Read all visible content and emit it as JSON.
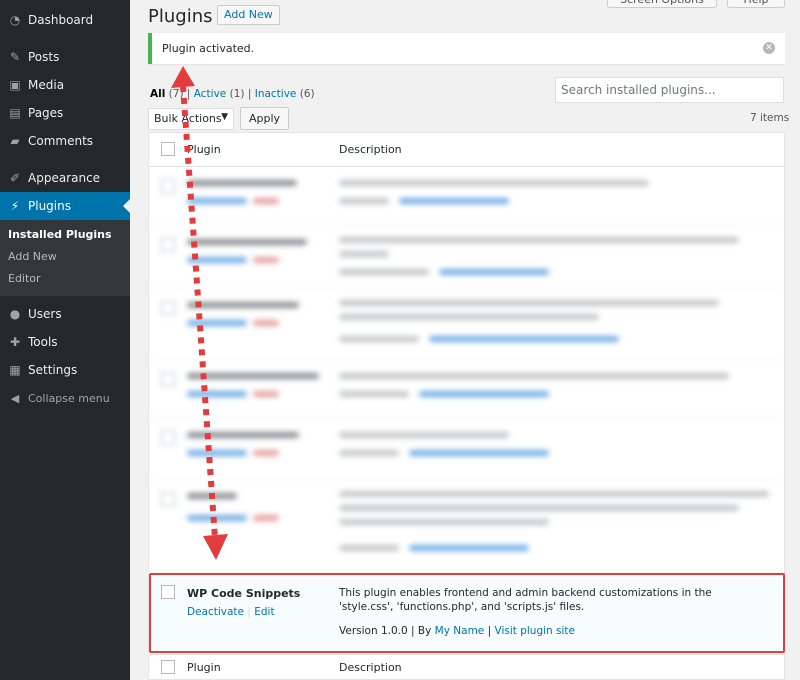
{
  "sidebar": {
    "items": [
      {
        "label": "Dashboard",
        "icon": "dashboard-icon"
      },
      {
        "label": "Posts",
        "icon": "pin-icon"
      },
      {
        "label": "Media",
        "icon": "media-icon"
      },
      {
        "label": "Pages",
        "icon": "page-icon"
      },
      {
        "label": "Comments",
        "icon": "comment-icon"
      },
      {
        "label": "Appearance",
        "icon": "brush-icon"
      },
      {
        "label": "Plugins",
        "icon": "plugin-icon"
      },
      {
        "label": "Users",
        "icon": "user-icon"
      },
      {
        "label": "Tools",
        "icon": "wrench-icon"
      },
      {
        "label": "Settings",
        "icon": "settings-icon"
      }
    ],
    "submenu": [
      "Installed Plugins",
      "Add New",
      "Editor"
    ],
    "collapse_label": "Collapse menu"
  },
  "header": {
    "title": "Plugins",
    "add_new": "Add New",
    "screen_options": "Screen Options",
    "help": "Help"
  },
  "notice": {
    "prefix": "Plugin ",
    "bold": "activated."
  },
  "filters": {
    "all": "All",
    "all_count": "(7)",
    "active": "Active",
    "active_count": "(1)",
    "inactive": "Inactive",
    "inactive_count": "(6)",
    "sep": "|"
  },
  "search": {
    "placeholder": "Search installed plugins..."
  },
  "bulk": {
    "label": "Bulk Actions",
    "apply": "Apply",
    "count": "7 items"
  },
  "table": {
    "col_plugin": "Plugin",
    "col_description": "Description"
  },
  "highlighted": {
    "name": "WP Code Snippets",
    "deactivate": "Deactivate",
    "edit": "Edit",
    "sep": "|",
    "description": "This plugin enables frontend and admin backend customizations in the 'style.css', 'functions.php', and 'scripts.js' files.",
    "version": "Version 1.0.0",
    "by": "By",
    "author": "My Name",
    "visit": "Visit plugin site"
  },
  "colors": {
    "accent": "#0073aa",
    "notice_green": "#46b450",
    "highlight_red": "#e33c3c"
  }
}
